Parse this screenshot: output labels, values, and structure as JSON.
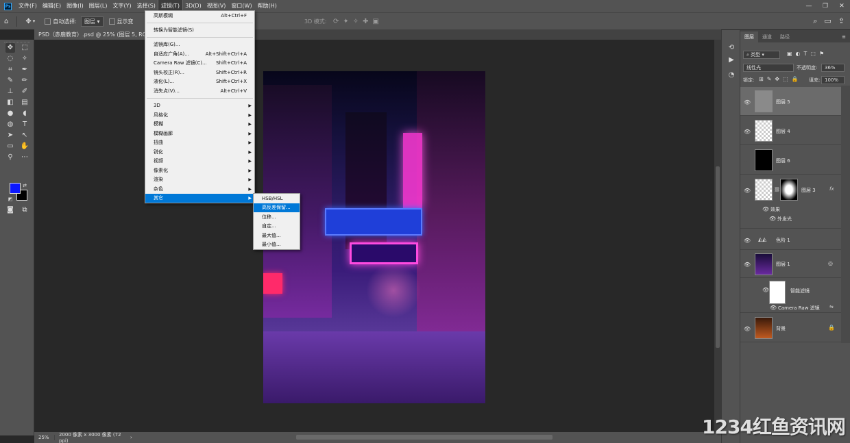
{
  "menubar": {
    "items": [
      "文件(F)",
      "编辑(E)",
      "图像(I)",
      "图层(L)",
      "文字(Y)",
      "选择(S)",
      "滤镜(T)",
      "3D(D)",
      "视图(V)",
      "窗口(W)",
      "帮助(H)"
    ],
    "active_index": 6,
    "logo": "Ps"
  },
  "options": {
    "auto_select_label": "自动选择:",
    "auto_select_value": "图层",
    "show_transform_label": "显示变",
    "mode_3d_label": "3D 模式:"
  },
  "document": {
    "tab_title": "PSD（赤鹿教育）.psd @ 25% (图层 5, RGB/8)"
  },
  "status": {
    "zoom": "25%",
    "info": "2000 像素 x 3000 像素 (72 ppi)"
  },
  "filter_menu": {
    "items": [
      {
        "label": "高斯模糊",
        "shortcut": "Alt+Ctrl+F"
      },
      {
        "label": "转换为智能滤镜(S)",
        "shortcut": ""
      },
      {
        "label": "滤镜库(G)...",
        "shortcut": ""
      },
      {
        "label": "自适应广角(A)...",
        "shortcut": "Alt+Shift+Ctrl+A"
      },
      {
        "label": "Camera Raw 滤镜(C)...",
        "shortcut": "Shift+Ctrl+A"
      },
      {
        "label": "镜头校正(R)...",
        "shortcut": "Shift+Ctrl+R"
      },
      {
        "label": "液化(L)...",
        "shortcut": "Shift+Ctrl+X"
      },
      {
        "label": "消失点(V)...",
        "shortcut": "Alt+Ctrl+V"
      },
      {
        "label": "3D",
        "shortcut": ""
      },
      {
        "label": "风格化",
        "shortcut": ""
      },
      {
        "label": "模糊",
        "shortcut": ""
      },
      {
        "label": "模糊画廊",
        "shortcut": ""
      },
      {
        "label": "扭曲",
        "shortcut": ""
      },
      {
        "label": "锐化",
        "shortcut": ""
      },
      {
        "label": "视频",
        "shortcut": ""
      },
      {
        "label": "像素化",
        "shortcut": ""
      },
      {
        "label": "渲染",
        "shortcut": ""
      },
      {
        "label": "杂色",
        "shortcut": ""
      },
      {
        "label": "其它",
        "shortcut": ""
      }
    ],
    "submenu": [
      "HSB/HSL",
      "高反差保留...",
      "位移...",
      "自定...",
      "最大值...",
      "最小值..."
    ],
    "submenu_highlight": "高反差保留..."
  },
  "layers_panel": {
    "tabs": [
      "图层",
      "通道",
      "路径"
    ],
    "filter_kind": "类型",
    "blend_mode": "线性光",
    "opacity_label": "不透明度:",
    "opacity_value": "36%",
    "lock_label": "锁定:",
    "fill_label": "填充:",
    "fill_value": "100%",
    "layers": [
      {
        "name": "图层 5"
      },
      {
        "name": "图层 4"
      },
      {
        "name": "图层 6"
      },
      {
        "name": "图层 3"
      },
      {
        "name": "效果"
      },
      {
        "name": "外发光"
      },
      {
        "name": "色阶 1"
      },
      {
        "name": "图层 1"
      },
      {
        "name": "智能滤镜"
      },
      {
        "name": "Camera Raw 滤镜"
      },
      {
        "name": "背景"
      }
    ]
  },
  "colors": {
    "foreground": "#0b17ff",
    "background": "#000000",
    "menu_highlight": "#0078d7"
  },
  "watermark": "1234红鱼资讯网"
}
